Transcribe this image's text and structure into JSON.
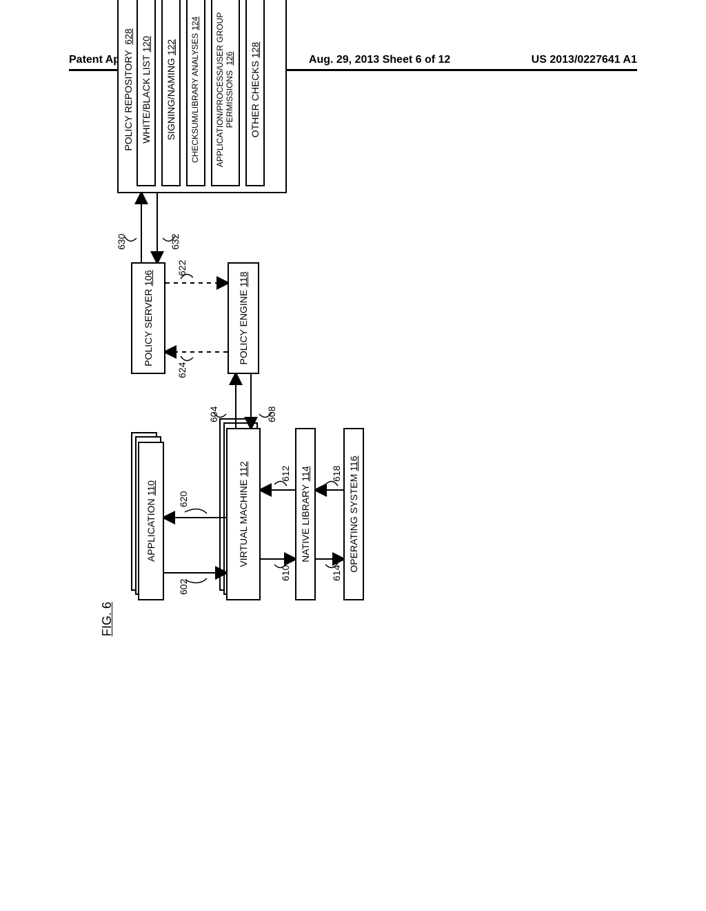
{
  "header": {
    "left": "Patent Application Publication",
    "center": "Aug. 29, 2013  Sheet 6 of 12",
    "right": "US 2013/0227641 A1"
  },
  "figure_label": "FIG. 6",
  "blocks": {
    "application": {
      "label": "APPLICATION",
      "ref": "110"
    },
    "virtual_machine": {
      "label": "VIRTUAL MACHINE",
      "ref": "112"
    },
    "native_library": {
      "label": "NATIVE LIBRARY",
      "ref": "114"
    },
    "operating_system": {
      "label": "OPERATING SYSTEM",
      "ref": "116"
    },
    "policy_server": {
      "label": "POLICY SERVER",
      "ref": "106"
    },
    "policy_engine": {
      "label": "POLICY ENGINE",
      "ref": "118"
    },
    "policy_repository": {
      "label": "POLICY REPOSITORY",
      "ref": "628"
    },
    "white_black": {
      "label": "WHITE/BLACK LIST",
      "ref": "120"
    },
    "signing_naming": {
      "label": "SIGNING/NAMING",
      "ref": "122"
    },
    "checksum": {
      "label": "CHECKSUM/LIBRARY ANALYSES",
      "ref": "124"
    },
    "permissions": {
      "label": "APPLICATION/PROCESS/USER GROUP PERMISSIONS",
      "ref": "126"
    },
    "other_checks": {
      "label": "OTHER CHECKS",
      "ref": "128"
    }
  },
  "arrow_refs": {
    "r602": "602",
    "r620": "620",
    "r604": "604",
    "r608": "608",
    "r610": "610",
    "r612": "612",
    "r614": "614",
    "r618": "618",
    "r624": "624",
    "r622": "622",
    "r630": "630",
    "r632": "632"
  }
}
